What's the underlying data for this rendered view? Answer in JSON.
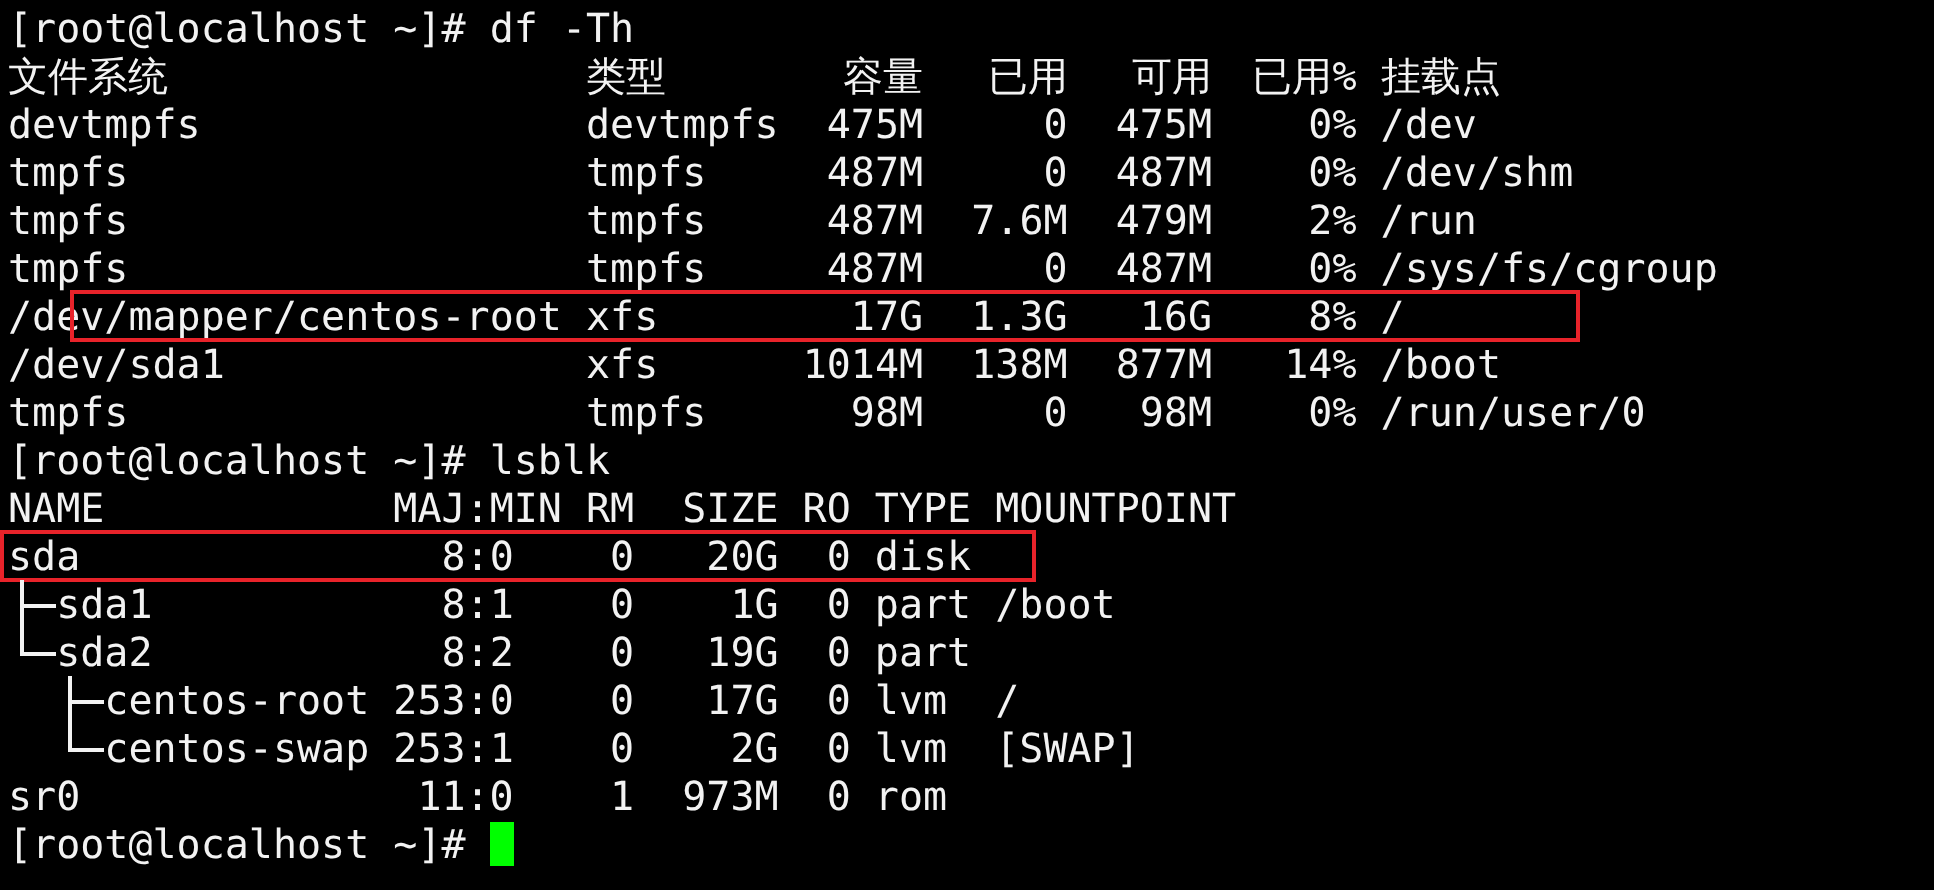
{
  "blocks": [
    {
      "kind": "prompt",
      "text": "[root@localhost ~]# df -Th"
    },
    {
      "kind": "df",
      "columns": [
        "文件系统",
        "类型",
        "容量",
        "已用",
        "可用",
        "已用%",
        "挂载点"
      ],
      "rows": [
        {
          "cells": [
            "devtmpfs",
            "devtmpfs",
            "475M",
            "0",
            "475M",
            "0%",
            "/dev"
          ],
          "highlighted": false
        },
        {
          "cells": [
            "tmpfs",
            "tmpfs",
            "487M",
            "0",
            "487M",
            "0%",
            "/dev/shm"
          ],
          "highlighted": false
        },
        {
          "cells": [
            "tmpfs",
            "tmpfs",
            "487M",
            "7.6M",
            "479M",
            "2%",
            "/run"
          ],
          "highlighted": false
        },
        {
          "cells": [
            "tmpfs",
            "tmpfs",
            "487M",
            "0",
            "487M",
            "0%",
            "/sys/fs/cgroup"
          ],
          "highlighted": false
        },
        {
          "cells": [
            "/dev/mapper/centos-root",
            "xfs",
            "17G",
            "1.3G",
            "16G",
            "8%",
            "/"
          ],
          "highlighted": true
        },
        {
          "cells": [
            "/dev/sda1",
            "xfs",
            "1014M",
            "138M",
            "877M",
            "14%",
            "/boot"
          ],
          "highlighted": false
        },
        {
          "cells": [
            "tmpfs",
            "tmpfs",
            "98M",
            "0",
            "98M",
            "0%",
            "/run/user/0"
          ],
          "highlighted": false
        }
      ]
    },
    {
      "kind": "prompt",
      "text": "[root@localhost ~]# lsblk"
    },
    {
      "kind": "lsblk",
      "columns": [
        "NAME",
        "MAJ:MIN",
        "RM",
        "SIZE",
        "RO",
        "TYPE",
        "MOUNTPOINT"
      ],
      "rows": [
        {
          "cells": [
            "sda",
            "8:0",
            "0",
            "20G",
            "0",
            "disk"
          ],
          "highlighted": true,
          "children": [
            {
              "cells": [
                "sda1",
                "8:1",
                "0",
                "1G",
                "0",
                "part",
                "/boot"
              ],
              "highlighted": false
            },
            {
              "cells": [
                "sda2",
                "8:2",
                "0",
                "19G",
                "0",
                "part"
              ],
              "highlighted": false,
              "children": [
                {
                  "cells": [
                    "centos-root",
                    "253:0",
                    "0",
                    "17G",
                    "0",
                    "lvm",
                    "/"
                  ],
                  "highlighted": false
                },
                {
                  "cells": [
                    "centos-swap",
                    "253:1",
                    "0",
                    "2G",
                    "0",
                    "lvm",
                    "[SWAP]"
                  ],
                  "highlighted": false
                }
              ]
            }
          ]
        },
        {
          "cells": [
            "sr0",
            "11:0",
            "1",
            "973M",
            "0",
            "rom"
          ],
          "highlighted": false
        }
      ]
    },
    {
      "kind": "prompt",
      "text": "[root@localhost ~]#",
      "cursor": true
    }
  ]
}
